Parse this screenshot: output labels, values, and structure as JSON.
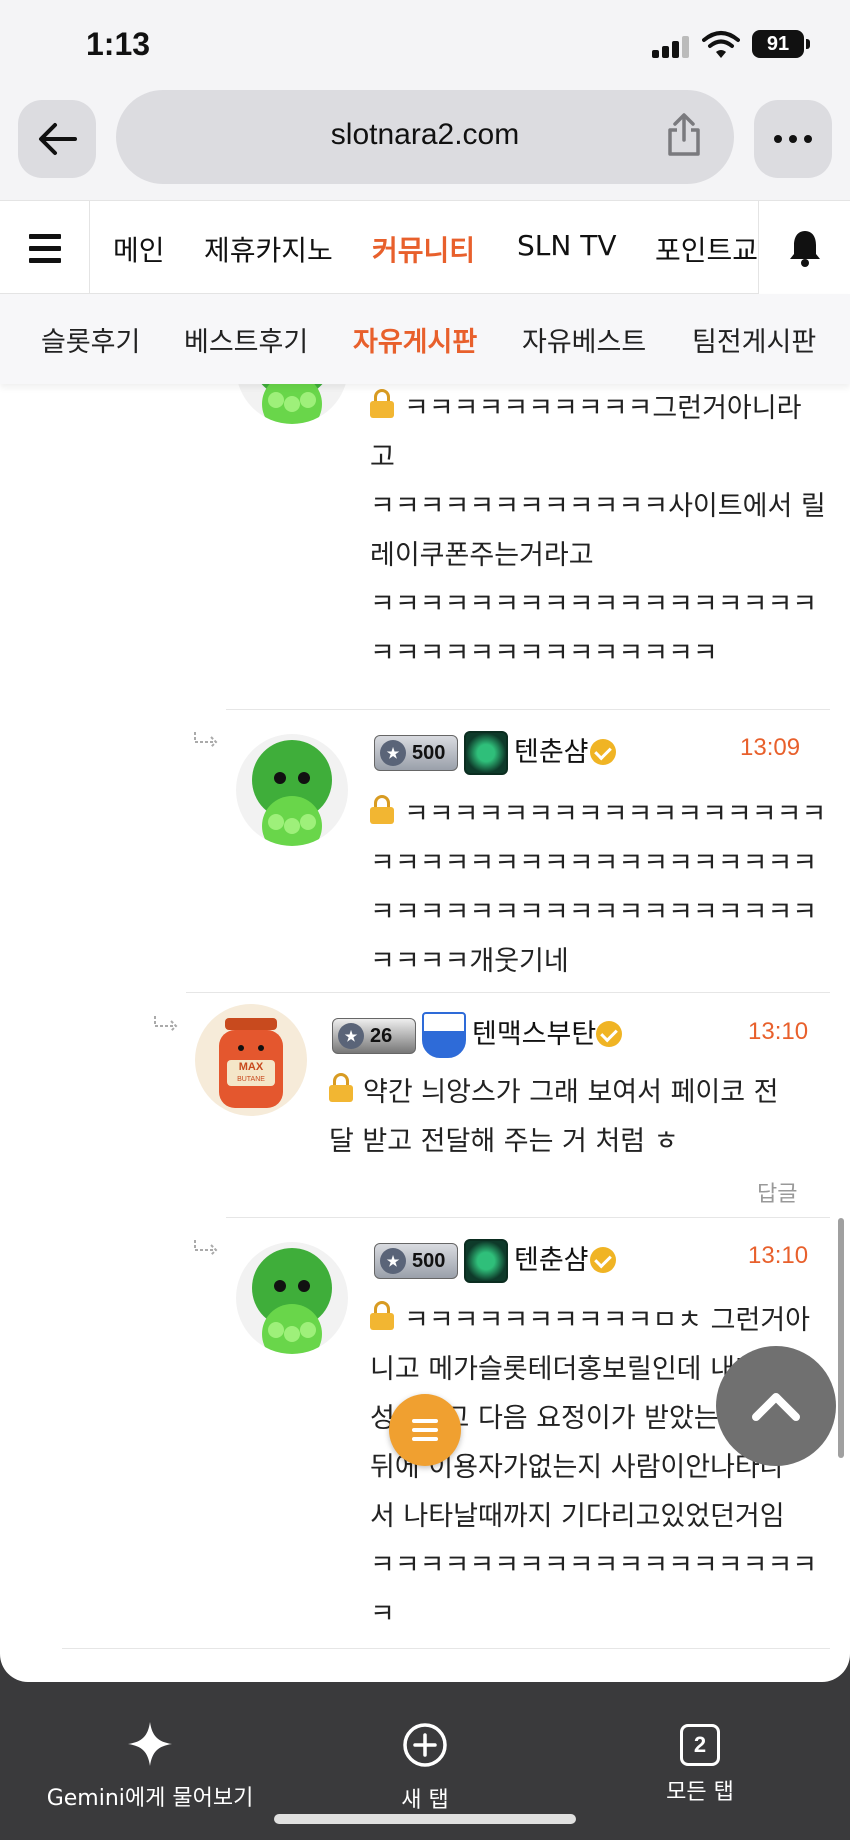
{
  "status_bar": {
    "time": "1:13",
    "battery": "91"
  },
  "browser": {
    "url": "slotnara2.com",
    "bottom": {
      "ask_gemini": "Gemini에게 물어보기",
      "new_tab": "새 탭",
      "all_tabs": "모든 탭",
      "tab_count": "2"
    }
  },
  "nav": {
    "main": [
      "메인",
      "제휴카지노",
      "커뮤니티",
      "SLN TV",
      "포인트교환"
    ],
    "main_active": "커뮤니티",
    "sub": [
      "슬롯후기",
      "베스트후기",
      "자유게시판",
      "자유베스트",
      "팀전게시판"
    ],
    "sub_active": "자유게시판"
  },
  "comments": [
    {
      "lines": [
        "ㅋㅋㅋㅋㅋㅋㅋㅋㅋㅋ그런거아니라",
        "고",
        "ㅋㅋㅋㅋㅋㅋㅋㅋㅋㅋㅋㅋ사이트에서 릴",
        "레이쿠폰주는거라고",
        "ㅋㅋㅋㅋㅋㅋㅋㅋㅋㅋㅋㅋㅋㅋㅋㅋㅋㅋ",
        "ㅋㅋㅋㅋㅋㅋㅋㅋㅋㅋㅋㅋㅋㅋ"
      ]
    },
    {
      "level": "500",
      "username": "텐춘샴",
      "time": "13:09",
      "lines": [
        "ㅋㅋㅋㅋㅋㅋㅋㅋㅋㅋㅋㅋㅋㅋㅋㅋㅋ",
        "ㅋㅋㅋㅋㅋㅋㅋㅋㅋㅋㅋㅋㅋㅋㅋㅋㅋㅋ",
        "ㅋㅋㅋㅋㅋㅋㅋㅋㅋㅋㅋㅋㅋㅋㅋㅋㅋㅋ",
        "ㅋㅋㅋㅋ개웃기네"
      ]
    },
    {
      "level": "26",
      "username": "텐맥스부탄",
      "time": "13:10",
      "lines": [
        "약간 늬앙스가 그래 보여서 페이코 전",
        "달 받고 전달해 주는 거 처럼 ㅎ"
      ],
      "reply_label": "답글"
    },
    {
      "level": "500",
      "username": "텐춘샴",
      "time": "13:10",
      "lines": [
        "ㅋㅋㅋㅋㅋㅋㅋㅋㅋㅋㅁㅊ 그런거아",
        "니고 메가슬롯테더홍보릴인데 내가",
        "성공하고 다음 요정이가 받았는데 그",
        "뒤에 이용자가없는지 사람이안나타나",
        "서 나타날때까지 기다리고있었던거임",
        "ㅋㅋㅋㅋㅋㅋㅋㅋㅋㅋㅋㅋㅋㅋㅋㅋㅋㅋ",
        "ㅋ"
      ]
    }
  ],
  "colors": {
    "accent": "#e8602c",
    "badge": "#f0b424",
    "fab_menu": "#f0a030"
  }
}
